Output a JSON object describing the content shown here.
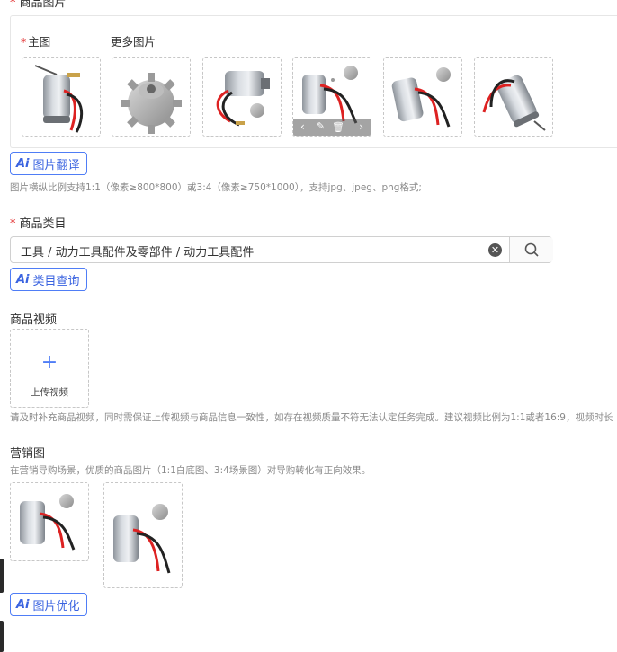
{
  "images_section": {
    "title": "商品图片",
    "main_label": "主图",
    "more_label": "更多图片",
    "thumbs": [
      {
        "name": "main-image-motor",
        "icon": "motor-photo-icon"
      },
      {
        "name": "image-gear",
        "icon": "gear-photo-icon"
      },
      {
        "name": "image-motor-gear-side",
        "icon": "motor-gear-photo-icon"
      },
      {
        "name": "image-motor-gear-hover",
        "icon": "motor-gear-photo-icon"
      },
      {
        "name": "image-motor-gear-angle",
        "icon": "motor-gear-photo-icon"
      },
      {
        "name": "image-motor-tilted",
        "icon": "motor-photo-icon"
      }
    ],
    "translate_button": "图片翻译",
    "help_text": "图片横纵比例支持1:1（像素≥800*800）或3:4（像素≥750*1000），支持jpg、jpeg、png格式;"
  },
  "category_section": {
    "title": "商品类目",
    "value": "工具 / 动力工具配件及零部件 / 动力工具配件",
    "query_button": "类目查询"
  },
  "video_section": {
    "title": "商品视频",
    "upload_label": "上传视频",
    "help_text": "请及时补充商品视频，同时需保证上传视频与商品信息一致性，如存在视频质量不符无法认定任务完成。建议视频比例为1:1或者16:9，视频时长"
  },
  "marketing_section": {
    "title": "营销图",
    "subtitle": "在营销导购场景，优质的商品图片（1:1白底图、3:4场景图）对导购转化有正向效果。",
    "optimize_button": "图片优化"
  },
  "ai_badge": "Ai",
  "colors": {
    "accent": "#3a63e0",
    "required": "#e02020",
    "border": "#d0d0d0"
  }
}
